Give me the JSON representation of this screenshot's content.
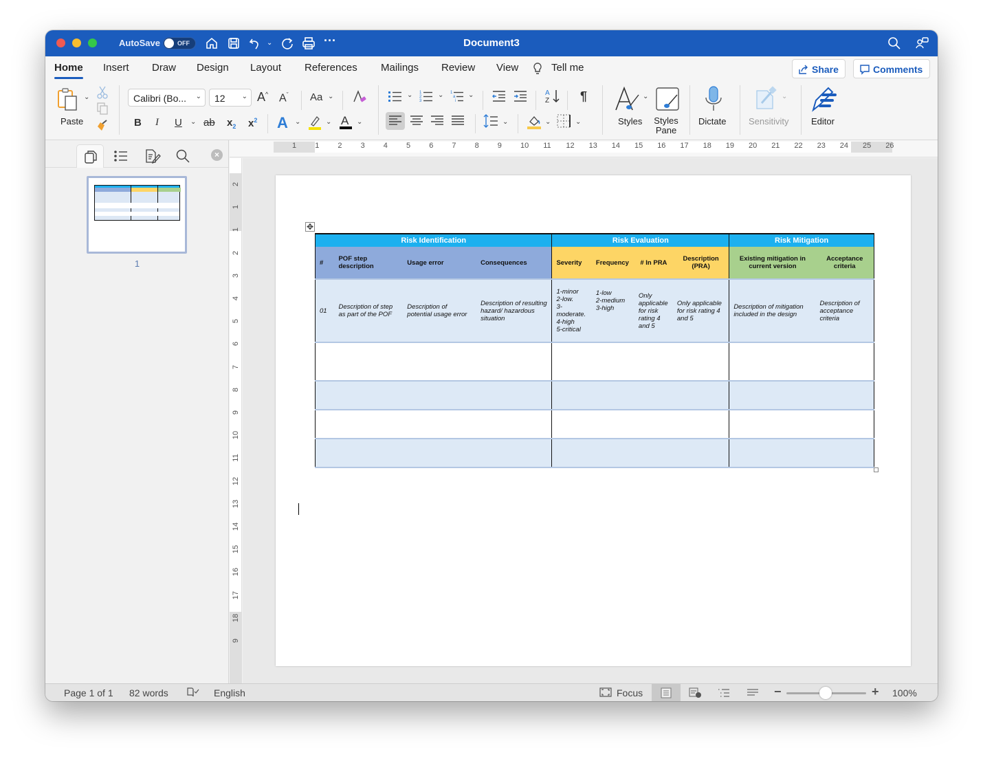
{
  "titlebar": {
    "autosave_label": "AutoSave",
    "autosave_state": "OFF",
    "document_title": "Document3",
    "icons": [
      "home-icon",
      "save-icon",
      "undo-icon",
      "redo-icon",
      "print-icon",
      "more-icon",
      "search-icon",
      "collaborate-icon"
    ]
  },
  "tabs": [
    {
      "label": "Home",
      "active": true
    },
    {
      "label": "Insert"
    },
    {
      "label": "Draw"
    },
    {
      "label": "Design"
    },
    {
      "label": "Layout"
    },
    {
      "label": "References"
    },
    {
      "label": "Mailings"
    },
    {
      "label": "Review"
    },
    {
      "label": "View"
    }
  ],
  "tell_me": "Tell me",
  "share_label": "Share",
  "comments_label": "Comments",
  "ribbon": {
    "paste_label": "Paste",
    "font_name": "Calibri (Bo...",
    "font_size": "12",
    "change_case": "Aa",
    "bold": "B",
    "italic": "I",
    "underline": "U",
    "strikethrough": "ab",
    "subscript": "x",
    "superscript": "x",
    "styles_label": "Styles",
    "styles_pane_label": "Styles Pane",
    "dictate_label": "Dictate",
    "sensitivity_label": "Sensitivity",
    "editor_label": "Editor",
    "pilcrow": "¶",
    "colors": {
      "highlight": "#f5e100",
      "font_color": "#000000",
      "shading": "#f7c94a",
      "accent": "#1b5cbd"
    }
  },
  "navpane": {
    "page_number": "1"
  },
  "ruler": {
    "horizontal_numbers": [
      "1",
      "1",
      "2",
      "3",
      "4",
      "5",
      "6",
      "7",
      "8",
      "9",
      "10",
      "11",
      "12",
      "13",
      "14",
      "15",
      "16",
      "17",
      "18",
      "19",
      "20",
      "21",
      "22",
      "23",
      "24",
      "25",
      "26"
    ],
    "vertical_numbers": [
      "2",
      "1",
      "1",
      "2",
      "3",
      "4",
      "5",
      "6",
      "7",
      "8",
      "9",
      "10",
      "11",
      "12",
      "13",
      "14",
      "15",
      "16",
      "17",
      "18",
      "9"
    ]
  },
  "table": {
    "groups": [
      {
        "label": "Risk Identification",
        "color": "#1cb0ef"
      },
      {
        "label": "Risk Evaluation",
        "color": "#1cb0ef"
      },
      {
        "label": "Risk Mitigation",
        "color": "#1cb0ef"
      }
    ],
    "headers": [
      "#",
      "POF step description",
      "Usage error",
      "Consequences",
      "Severity",
      "Frequency",
      "# In PRA",
      "Description (PRA)",
      "Existing mitigation in current version",
      "Acceptance criteria"
    ],
    "header_colors": {
      "identification": "#8eaadb",
      "evaluation": "#fdd565",
      "mitigation": "#a8d08d"
    },
    "row1": [
      "01",
      "Description of step as part of the POF",
      "Description of potential usage error",
      "Description of resulting hazard/ hazardous situation",
      "1-minor\n2-low.\n3-moderate.\n4-high\n5-critical",
      "1-low\n2-medium\n3-high",
      "Only applicable for risk rating 4 and 5",
      "Only applicable for risk rating 4 and 5",
      "Description of mitigation included in the design",
      "Description of acceptance criteria"
    ]
  },
  "statusbar": {
    "page": "Page 1 of 1",
    "words": "82 words",
    "language": "English",
    "focus": "Focus",
    "zoom": "100%",
    "zoom_level_percent": 100
  }
}
